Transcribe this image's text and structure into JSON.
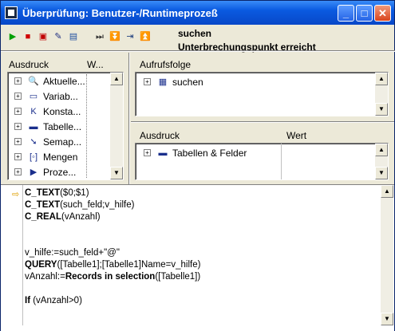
{
  "window": {
    "title": "Überprüfung: Benutzer-/Runtimeprozeß",
    "controls": {
      "minimize": "_",
      "maximize": "□",
      "close": "✕"
    }
  },
  "toolbar": {
    "buttons": [
      {
        "name": "run-icon",
        "glyph": "▶",
        "color": "#00a000"
      },
      {
        "name": "stop-icon",
        "glyph": "■",
        "color": "#d00000"
      },
      {
        "name": "abort-icon",
        "glyph": "▣",
        "color": "#c00000"
      },
      {
        "name": "edit-icon",
        "glyph": "✎",
        "color": "#203080"
      },
      {
        "name": "book-icon",
        "glyph": "▤",
        "color": "#2050a0"
      },
      {
        "name": "step-over-icon",
        "glyph": "⏭",
        "color": "#303030"
      },
      {
        "name": "step-into-icon",
        "glyph": "⏬",
        "color": "#303030"
      },
      {
        "name": "trace-icon",
        "glyph": "⇥",
        "color": "#204080"
      },
      {
        "name": "step-out-icon",
        "glyph": "⏫",
        "color": "#303030"
      }
    ],
    "status_method": "suchen",
    "status_message": "Unterbrechungspunkt erreicht"
  },
  "expressions": {
    "col_expression": "Ausdruck",
    "col_value": "W...",
    "items": [
      {
        "icon": "magnifier-icon",
        "glyph": "🔍",
        "label": "Aktuelle..."
      },
      {
        "icon": "variables-icon",
        "glyph": "▭",
        "label": "Variab..."
      },
      {
        "icon": "constants-icon",
        "glyph": "K",
        "label": "Konsta..."
      },
      {
        "icon": "table-icon",
        "glyph": "▬",
        "label": "Tabelle..."
      },
      {
        "icon": "semaphore-icon",
        "glyph": "➘",
        "label": "Semap..."
      },
      {
        "icon": "sets-icon",
        "glyph": "[◦]",
        "label": "Mengen"
      },
      {
        "icon": "process-icon",
        "glyph": "▶",
        "label": "Proze..."
      }
    ]
  },
  "callchain": {
    "header": "Aufrufsfolge",
    "items": [
      {
        "icon": "method-icon",
        "glyph": "▦",
        "label": "suchen"
      }
    ]
  },
  "custom_watch": {
    "col_expression": "Ausdruck",
    "col_value": "Wert",
    "items": [
      {
        "icon": "table-fields-icon",
        "glyph": "▬",
        "label": "Tabellen & Felder"
      }
    ]
  },
  "source": {
    "lines": [
      [
        {
          "t": "C_TEXT",
          "b": true
        },
        {
          "t": "($0;$1)",
          "b": false
        }
      ],
      [
        {
          "t": "C_TEXT",
          "b": true
        },
        {
          "t": "(such_feld;v_hilfe)",
          "b": false
        }
      ],
      [
        {
          "t": "C_REAL",
          "b": true
        },
        {
          "t": "(vAnzahl)",
          "b": false
        }
      ],
      [],
      [],
      [
        {
          "t": "v_hilfe:=such_feld+\"@\"",
          "b": false
        }
      ],
      [
        {
          "t": "QUERY",
          "b": true
        },
        {
          "t": "([Tabelle1];[Tabelle1]Name=v_hilfe)",
          "b": false
        }
      ],
      [
        {
          "t": "vAnzahl:=",
          "b": false
        },
        {
          "t": "Records in selection",
          "b": true
        },
        {
          "t": "([Tabelle1])",
          "b": false
        }
      ],
      [],
      [
        {
          "t": "If",
          "b": true
        },
        {
          "t": " (vAnzahl>0)",
          "b": false
        }
      ]
    ],
    "current_line_marker": "⇨"
  }
}
